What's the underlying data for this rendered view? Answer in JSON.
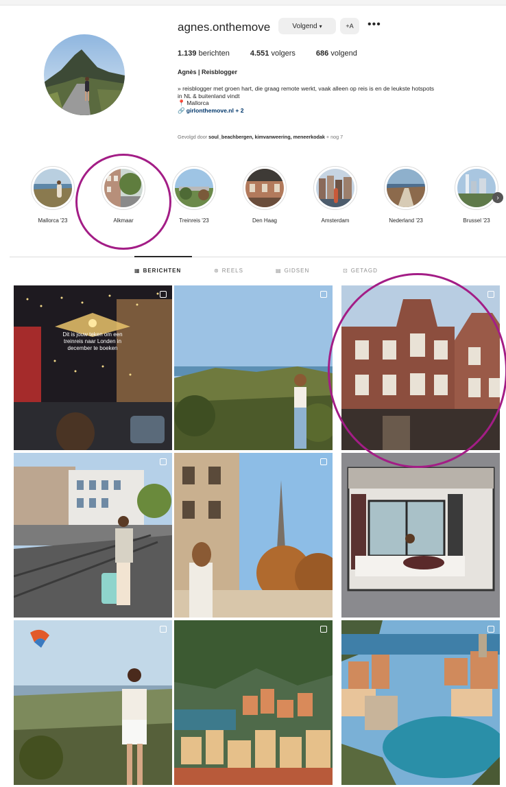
{
  "profile": {
    "username": "agnes.onthemove",
    "follow_button": "Volgend",
    "suggest_button": "+A",
    "more_button": "•••",
    "stats": {
      "posts_count": "1.139",
      "posts_label": "berichten",
      "followers_count": "4.551",
      "followers_label": "volgers",
      "following_count": "686",
      "following_label": "volgend"
    },
    "full_name": "Agnès | Reisblogger",
    "bio_line1": "» reisblogger met groen hart, die graag remote werkt, vaak alleen op reis is en de leukste hotspots",
    "bio_line2": "in NL & buitenland vindt",
    "bio_location": "Mallorca",
    "bio_link": "girlonthemove.nl + 2",
    "followed_by_prefix": "Gevolgd door ",
    "followed_by_names": "soul_beachbergen, kimvanweering, meneerkodak",
    "followed_by_suffix": " + nog 7"
  },
  "highlights": [
    {
      "label": "Mallorca '23"
    },
    {
      "label": "Alkmaar"
    },
    {
      "label": "Treinreis '23"
    },
    {
      "label": "Den Haag"
    },
    {
      "label": "Amsterdam"
    },
    {
      "label": "Nederland '23"
    },
    {
      "label": "Brussel '23"
    }
  ],
  "tabs": [
    {
      "label": "BERICHTEN",
      "icon": "grid-icon",
      "active": true
    },
    {
      "label": "REELS",
      "icon": "reels-icon",
      "active": false
    },
    {
      "label": "GIDSEN",
      "icon": "guides-icon",
      "active": false
    },
    {
      "label": "GETAGD",
      "icon": "tagged-icon",
      "active": false
    }
  ],
  "posts": [
    {
      "overlay_text_1": "Dit is jouw teken om een",
      "overlay_text_2": "treinreis naar Londen in",
      "overlay_text_3": "december te boeken"
    },
    {},
    {},
    {},
    {},
    {},
    {},
    {},
    {}
  ],
  "colors": {
    "annotation": "#a31d86",
    "link": "#00376b",
    "secondary_text": "#737373"
  }
}
